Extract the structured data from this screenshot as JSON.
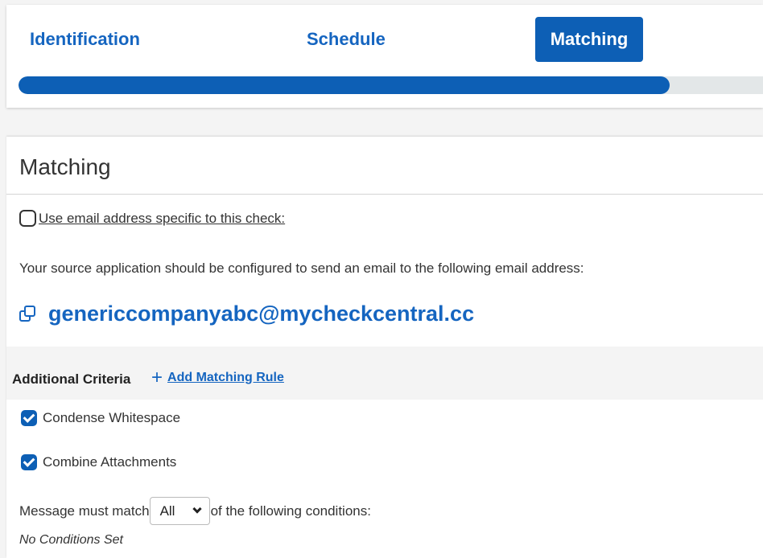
{
  "wizard": {
    "steps": [
      {
        "label": "Identification"
      },
      {
        "label": "Schedule"
      },
      {
        "label": "Matching"
      }
    ],
    "progress_fraction": 0.875
  },
  "matching": {
    "title": "Matching",
    "email_toggle_label": "Use email address specific to this check:",
    "instruction": "Your source application should be configured to send an email to the following email address:",
    "email_address": "genericcompanyabc@mycheckcentral.cc"
  },
  "criteria": {
    "title": "Additional Criteria",
    "add_rule_label": "Add Matching Rule",
    "options": [
      {
        "label": "Condense Whitespace"
      },
      {
        "label": "Combine Attachments"
      }
    ],
    "match_prefix": "Message must match",
    "match_mode": "All",
    "match_suffix": "of the following conditions:",
    "no_conditions": "No Conditions Set"
  },
  "colors": {
    "accent": "#0d5fb5",
    "link": "#1565c0",
    "background": "#f4f4f4"
  },
  "icons": {
    "copy": "copy-icon",
    "add": "plus-icon",
    "select": "chevron-down-icon"
  }
}
